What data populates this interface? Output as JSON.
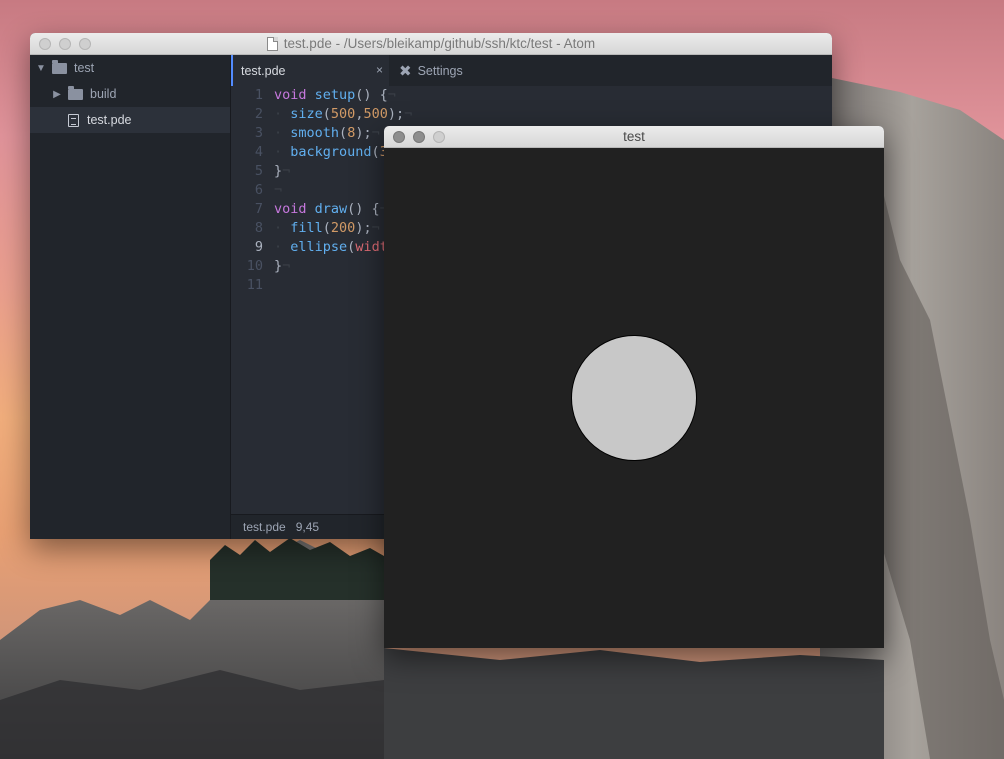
{
  "atom": {
    "window_title": "test.pde - /Users/bleikamp/github/ssh/ktc/test - Atom",
    "tree": {
      "root": "test",
      "items": [
        {
          "label": "build",
          "type": "folder"
        },
        {
          "label": "test.pde",
          "type": "file"
        }
      ]
    },
    "tabs": {
      "active": "test.pde",
      "close_glyph": "×",
      "settings": "Settings"
    },
    "gutter": [
      "1",
      "2",
      "3",
      "4",
      "5",
      "6",
      "7",
      "8",
      "9",
      "10",
      "11"
    ],
    "status": {
      "file": "test.pde",
      "cursor": "9,45"
    }
  },
  "sketch": {
    "window_title": "test",
    "ellipse_fill": "#c8c8c8",
    "background": "#212121"
  },
  "colors": {
    "keyword": "#c678dd",
    "function": "#61afef",
    "number": "#d19a66",
    "accent": "#528bff"
  }
}
